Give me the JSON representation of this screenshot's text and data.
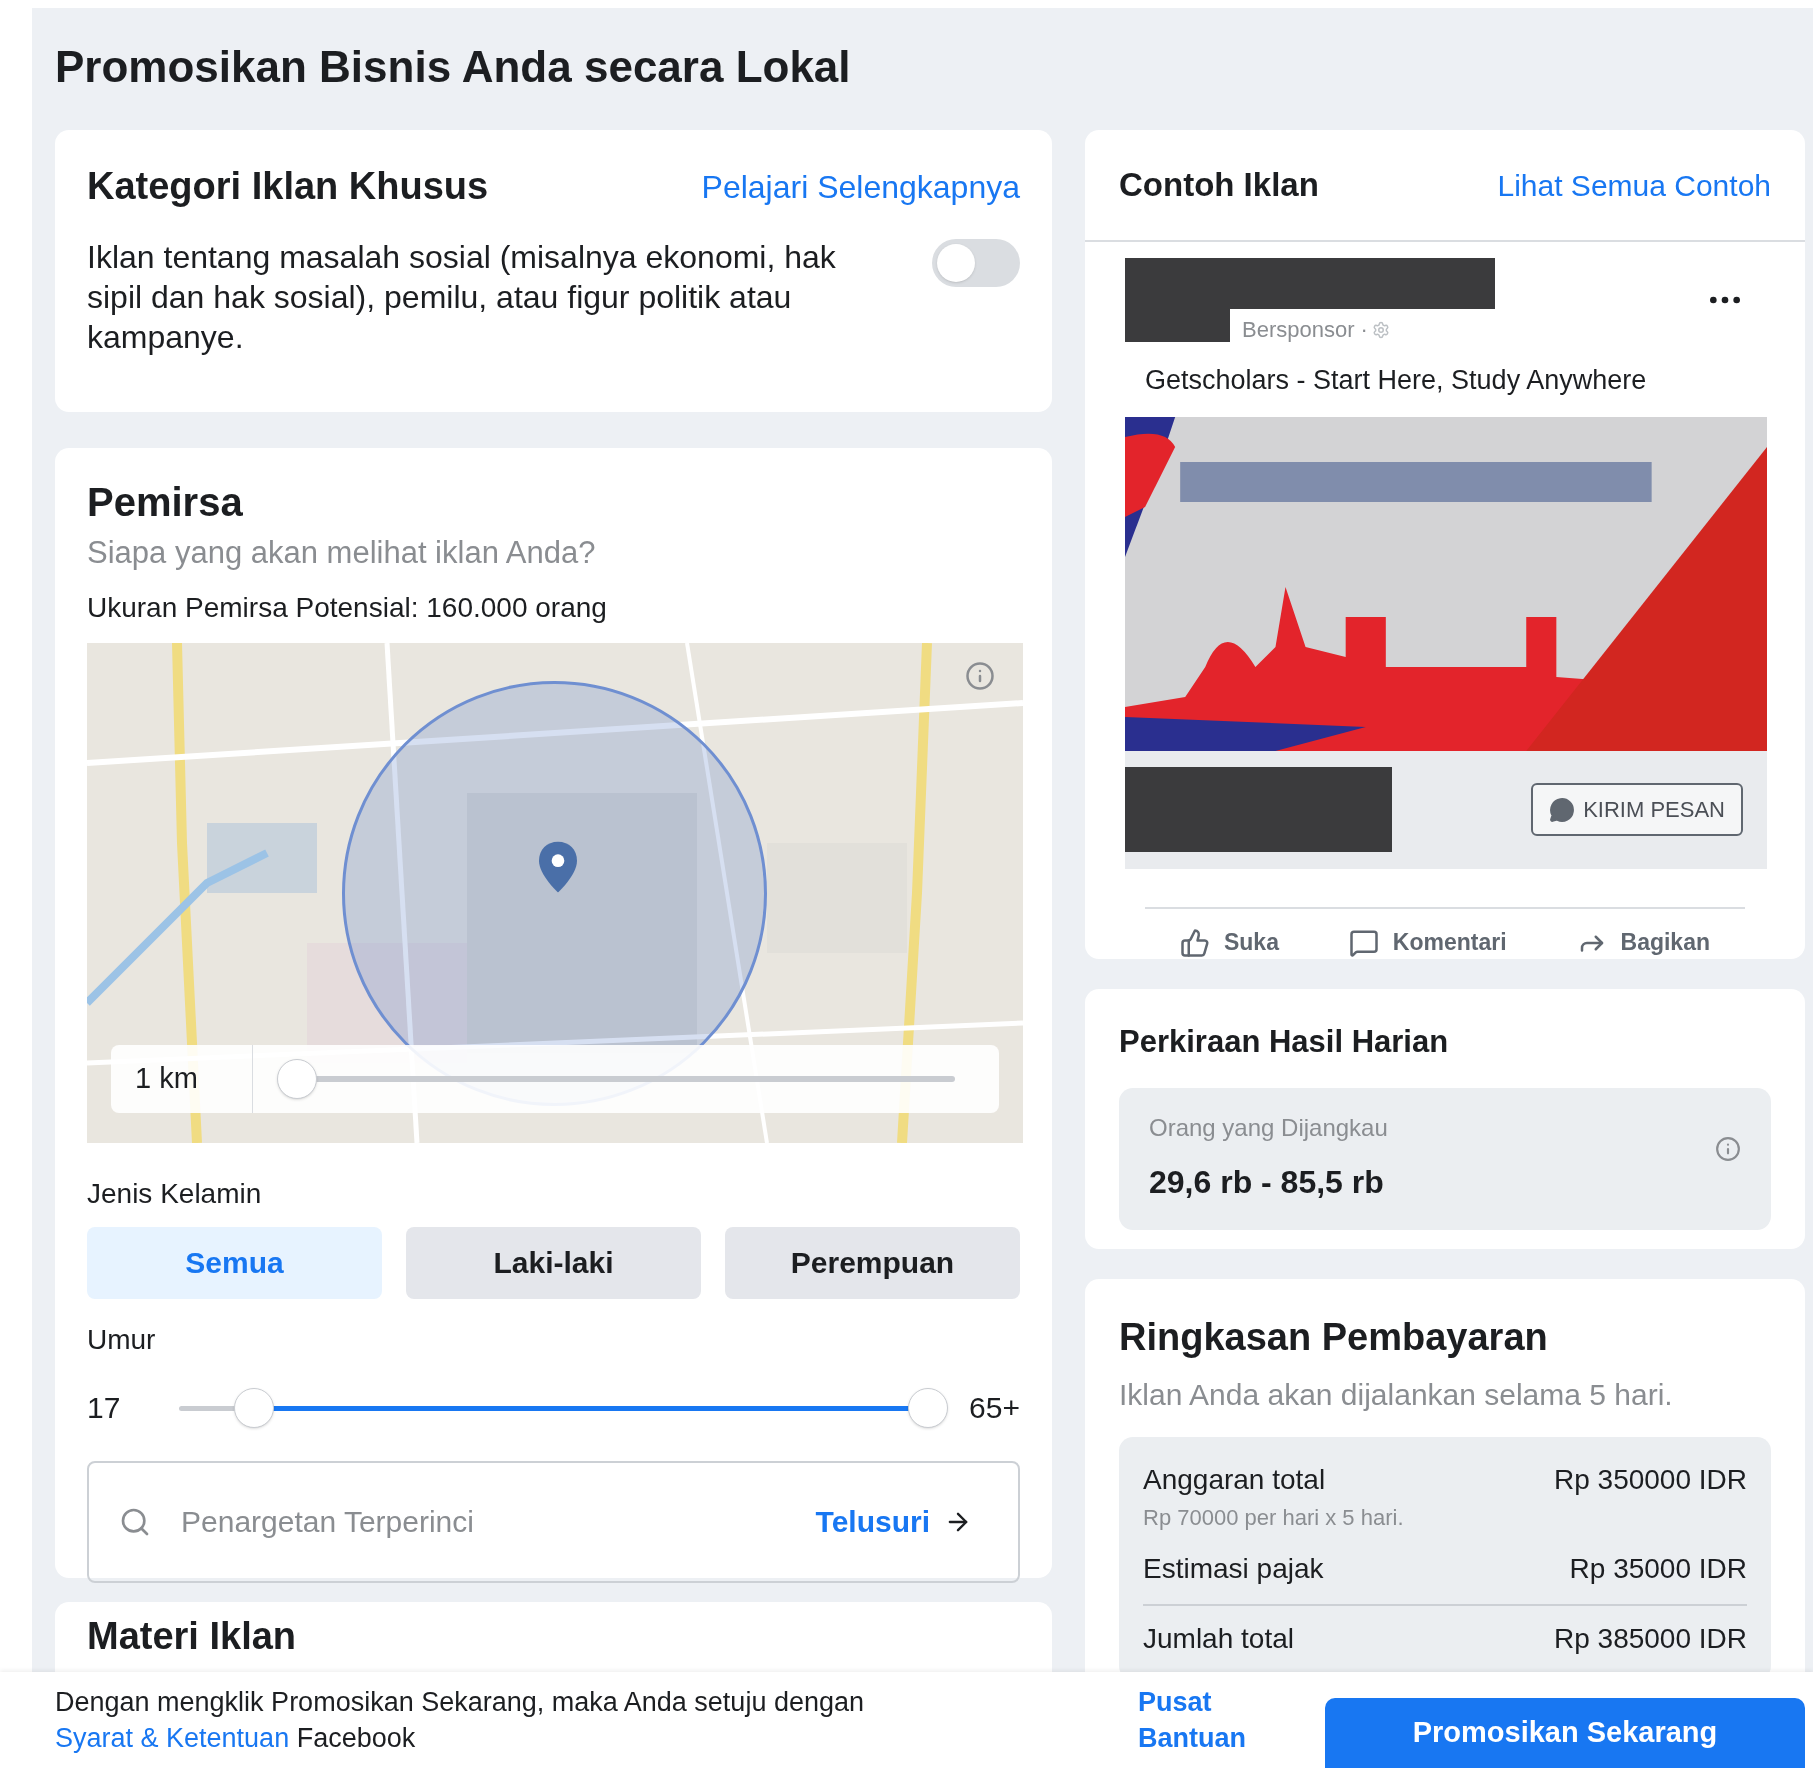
{
  "title": "Promosikan Bisnis Anda secara Lokal",
  "special_category": {
    "heading": "Kategori Iklan Khusus",
    "link": "Pelajari Selengkapnya",
    "description": "Iklan tentang masalah sosial (misalnya ekonomi, hak sipil dan hak sosial), pemilu, atau figur politik atau kampanye.",
    "on": false
  },
  "audience": {
    "heading": "Pemirsa",
    "subtitle": "Siapa yang akan melihat iklan Anda?",
    "potential_size": "Ukuran Pemirsa Potensial: 160.000 orang",
    "map": {
      "radius": "1 km",
      "level": 0
    },
    "gender_label": "Jenis Kelamin",
    "genders": [
      {
        "label": "Semua",
        "selected": true
      },
      {
        "label": "Laki-laki",
        "selected": false
      },
      {
        "label": "Perempuan",
        "selected": false
      }
    ],
    "age_label": "Umur",
    "age_min": "17",
    "age_max": "65+",
    "age_slider": {
      "low": {
        "level": 0.1
      },
      "high": {
        "level": 1
      }
    },
    "detailed_targeting": {
      "placeholder": "Penargetan Terperinci",
      "action": "Telusuri"
    }
  },
  "ad_material": {
    "heading": "Materi Iklan"
  },
  "ad_preview": {
    "heading": "Contoh Iklan",
    "link": "Lihat Semua Contoh",
    "sponsored": "Bersponsor ·",
    "headline": "Getscholars - Start Here, Study Anywhere",
    "cta": "KIRIM PESAN",
    "actions": [
      {
        "label": "Suka",
        "kind": "like"
      },
      {
        "label": "Komentari",
        "kind": "comment"
      },
      {
        "label": "Bagikan",
        "kind": "share"
      }
    ]
  },
  "daily_results": {
    "heading": "Perkiraan Hasil Harian",
    "metric_label": "Orang yang Dijangkau",
    "metric_value": "29,6 rb - 85,5 rb"
  },
  "payment_summary": {
    "heading": "Ringkasan Pembayaran",
    "subtitle": "Iklan Anda akan dijalankan selama 5 hari.",
    "rows": [
      {
        "label": "Anggaran total",
        "note": "Rp 70000 per hari x 5 hari.",
        "value": "Rp 350000 IDR"
      },
      {
        "label": "Estimasi pajak",
        "value": "Rp 35000 IDR"
      },
      {
        "label": "Jumlah total",
        "value": "Rp 385000 IDR"
      }
    ]
  },
  "footer": {
    "agreement": "Dengan mengklik Promosikan Sekarang, maka Anda setuju dengan",
    "terms_link": "Syarat & Ketentuan",
    "terms_suffix": "Facebook",
    "help_link": "Pusat Bantuan",
    "promote_button": "Promosikan Sekarang"
  }
}
